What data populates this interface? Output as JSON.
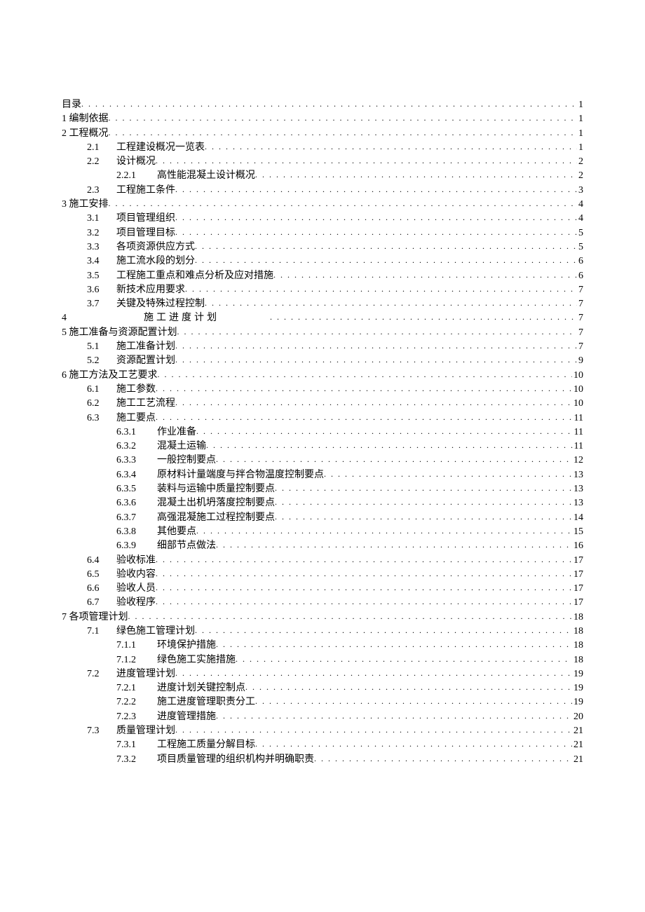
{
  "toc": [
    {
      "level": 1,
      "num": "",
      "title": "目录",
      "page": "1"
    },
    {
      "level": 1,
      "num": "",
      "title": "1 编制依据",
      "page": "1"
    },
    {
      "level": 1,
      "num": "",
      "title": "2 工程概况",
      "page": "1"
    },
    {
      "level": 2,
      "num": "2.1",
      "title": "工程建设概况一览表",
      "page": "1"
    },
    {
      "level": 2,
      "num": "2.2",
      "title": "设计概况",
      "page": "2"
    },
    {
      "level": 3,
      "num": "2.2.1",
      "title": "高性能混凝土设计概况",
      "page": "2"
    },
    {
      "level": 2,
      "num": "2.3",
      "title": "工程施工条件",
      "page": "3"
    },
    {
      "level": 1,
      "num": "",
      "title": "3 施工安排",
      "page": "4"
    },
    {
      "level": 2,
      "num": "3.1",
      "title": "项目管理组织",
      "page": "4"
    },
    {
      "level": 2,
      "num": "3.2",
      "title": "项目管理目标",
      "page": "5"
    },
    {
      "level": 2,
      "num": "3.3",
      "title": "各项资源供应方式",
      "page": "5"
    },
    {
      "level": 2,
      "num": "3.4",
      "title": "施工流水段的划分",
      "page": "6"
    },
    {
      "level": 2,
      "num": "3.5",
      "title": "工程施工重点和难点分析及应对措施",
      "page": "6"
    },
    {
      "level": 2,
      "num": "3.6",
      "title": "新技术应用要求",
      "page": "7"
    },
    {
      "level": 2,
      "num": "3.7",
      "title": "关键及特殊过程控制",
      "page": "7"
    },
    {
      "level": 1,
      "num": "4",
      "title": "施工进度计划",
      "page": "7",
      "spaced": true
    },
    {
      "level": 1,
      "num": "",
      "title": "5 施工准备与资源配置计划",
      "page": "7"
    },
    {
      "level": 2,
      "num": "5.1",
      "title": "施工准备计划",
      "page": "7"
    },
    {
      "level": 2,
      "num": "5.2",
      "title": "资源配置计划",
      "page": "9"
    },
    {
      "level": 1,
      "num": "",
      "title": "6 施工方法及工艺要求",
      "page": "10"
    },
    {
      "level": 2,
      "num": "6.1",
      "title": "施工参数",
      "page": "10"
    },
    {
      "level": 2,
      "num": "6.2",
      "title": "施工工艺流程",
      "page": "10"
    },
    {
      "level": 2,
      "num": "6.3",
      "title": "施工要点",
      "page": "11"
    },
    {
      "level": 3,
      "num": "6.3.1",
      "title": "作业准备",
      "page": "11"
    },
    {
      "level": 3,
      "num": "6.3.2",
      "title": "混凝土运输",
      "page": "11"
    },
    {
      "level": 3,
      "num": "6.3.3",
      "title": "一般控制要点",
      "page": "12"
    },
    {
      "level": 3,
      "num": "6.3.4",
      "title": "原材料计量端度与拌合物温度控制要点",
      "page": "13"
    },
    {
      "level": 3,
      "num": "6.3.5",
      "title": "装料与运输中质量控制要点",
      "page": "13"
    },
    {
      "level": 3,
      "num": "6.3.6",
      "title": "混凝土出机坍落度控制要点",
      "page": "13"
    },
    {
      "level": 3,
      "num": "6.3.7",
      "title": "高强混凝施工过程控制要点",
      "page": "14"
    },
    {
      "level": 3,
      "num": "6.3.8",
      "title": "其他要点",
      "page": "15"
    },
    {
      "level": 3,
      "num": "6.3.9",
      "title": "细部节点做法",
      "page": "16"
    },
    {
      "level": 2,
      "num": "6.4",
      "title": "验收标准",
      "page": "17"
    },
    {
      "level": 2,
      "num": "6.5",
      "title": "验收内容",
      "page": "17"
    },
    {
      "level": 2,
      "num": "6.6",
      "title": "验收人员",
      "page": "17"
    },
    {
      "level": 2,
      "num": "6.7",
      "title": "验收程序",
      "page": "17"
    },
    {
      "level": 1,
      "num": "",
      "title": "7 各项管理计划",
      "page": "18"
    },
    {
      "level": 2,
      "num": "7.1",
      "title": "绿色施工管理计划",
      "page": "18"
    },
    {
      "level": 3,
      "num": "7.1.1",
      "title": "环境保护措施",
      "page": "18"
    },
    {
      "level": 3,
      "num": "7.1.2",
      "title": "绿色施工实施措施",
      "page": "18"
    },
    {
      "level": 2,
      "num": "7.2",
      "title": "进度管理计划",
      "page": "19"
    },
    {
      "level": 3,
      "num": "7.2.1",
      "title": "进度计划关键控制点",
      "page": "19"
    },
    {
      "level": 3,
      "num": "7.2.2",
      "title": "施工进度管理职责分工",
      "page": "19"
    },
    {
      "level": 3,
      "num": "7.2.3",
      "title": "进度管理措施",
      "page": "20"
    },
    {
      "level": 2,
      "num": "7.3",
      "title": "质量管理计划",
      "page": "21"
    },
    {
      "level": 3,
      "num": "7.3.1",
      "title": "工程施工质量分解目标",
      "page": "21"
    },
    {
      "level": 3,
      "num": "7.3.2",
      "title": "项目质量管理的组织机构并明确职责",
      "page": "21"
    }
  ]
}
